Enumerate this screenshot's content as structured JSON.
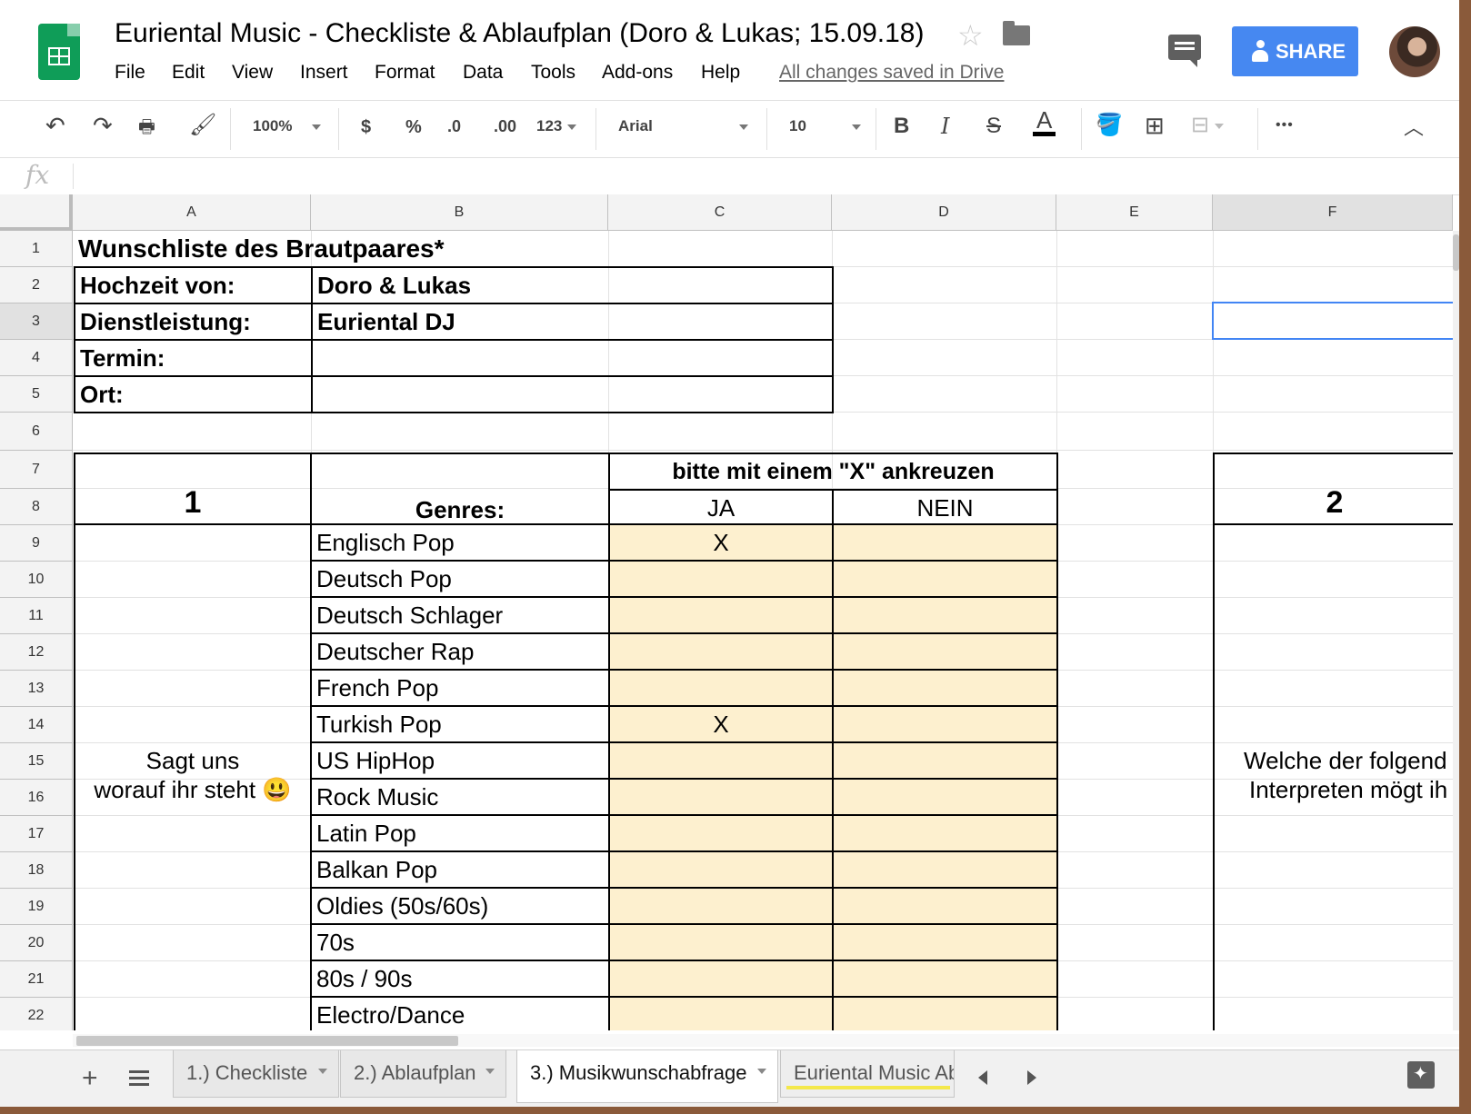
{
  "app": {
    "title": "Euriental Music - Checkliste & Ablaufplan (Doro & Lukas; 15.09.18)",
    "menu": [
      "File",
      "Edit",
      "View",
      "Insert",
      "Format",
      "Data",
      "Tools",
      "Add-ons",
      "Help"
    ],
    "saved_status": "All changes saved in Drive",
    "share_label": "SHARE"
  },
  "toolbar": {
    "zoom": "100%",
    "currency": "$",
    "percent": "%",
    "dec_less": ".0",
    "dec_more": ".00",
    "more_formats": "123",
    "font": "Arial",
    "font_size": "10",
    "bold": "B",
    "italic": "I",
    "strike": "S",
    "text_color": "A",
    "more": "•••"
  },
  "formula_bar": {
    "fx_label": "fx",
    "content": ""
  },
  "columns": [
    "A",
    "B",
    "C",
    "D",
    "E",
    "F"
  ],
  "rows": [
    "1",
    "2",
    "3",
    "4",
    "5",
    "6",
    "7",
    "8",
    "9",
    "10",
    "11",
    "12",
    "13",
    "14",
    "15",
    "16",
    "17",
    "18",
    "19",
    "20",
    "21",
    "22"
  ],
  "sheet": {
    "title": "Wunschliste des Brautpaares*",
    "info_labels": [
      "Hochzeit von:",
      "Dienstleistung:",
      "Termin:",
      "Ort:"
    ],
    "info_values": [
      "Doro & Lukas",
      "Euriental DJ",
      "",
      ""
    ],
    "section1_number": "1",
    "genres_header": "Genres:",
    "instruction": "bitte mit einem \"X\" ankreuzen",
    "ja": "JA",
    "nein": "NEIN",
    "section1_text": [
      "Sagt uns",
      "worauf ihr steht 😃"
    ],
    "genres": [
      {
        "name": "Englisch Pop",
        "ja": "X",
        "nein": ""
      },
      {
        "name": "Deutsch Pop",
        "ja": "",
        "nein": ""
      },
      {
        "name": "Deutsch Schlager",
        "ja": "",
        "nein": ""
      },
      {
        "name": "Deutscher Rap",
        "ja": "",
        "nein": ""
      },
      {
        "name": "French Pop",
        "ja": "",
        "nein": ""
      },
      {
        "name": "Turkish Pop",
        "ja": "X",
        "nein": ""
      },
      {
        "name": "US HipHop",
        "ja": "",
        "nein": ""
      },
      {
        "name": "Rock Music",
        "ja": "",
        "nein": ""
      },
      {
        "name": "Latin Pop",
        "ja": "",
        "nein": ""
      },
      {
        "name": "Balkan Pop",
        "ja": "",
        "nein": ""
      },
      {
        "name": "Oldies (50s/60s)",
        "ja": "",
        "nein": ""
      },
      {
        "name": "70s",
        "ja": "",
        "nein": ""
      },
      {
        "name": "80s / 90s",
        "ja": "",
        "nein": ""
      },
      {
        "name": "Electro/Dance",
        "ja": "",
        "nein": ""
      }
    ],
    "section2_number": "2",
    "section2_text": [
      "Welche der folgend",
      "Interpreten mögt ih"
    ]
  },
  "tabs": [
    {
      "label": "1.) Checkliste",
      "active": false
    },
    {
      "label": "2.) Ablaufplan",
      "active": false
    },
    {
      "label": "3.) Musikwunschabfrage",
      "active": true
    },
    {
      "label": "Euriental Music Ab",
      "active": false
    }
  ],
  "colors": {
    "accent": "#4285f4",
    "share": "#4688f1",
    "highlight": "#fdf0cf",
    "sheets_green": "#0f9d58",
    "tab_underline": "#f4e84a"
  }
}
